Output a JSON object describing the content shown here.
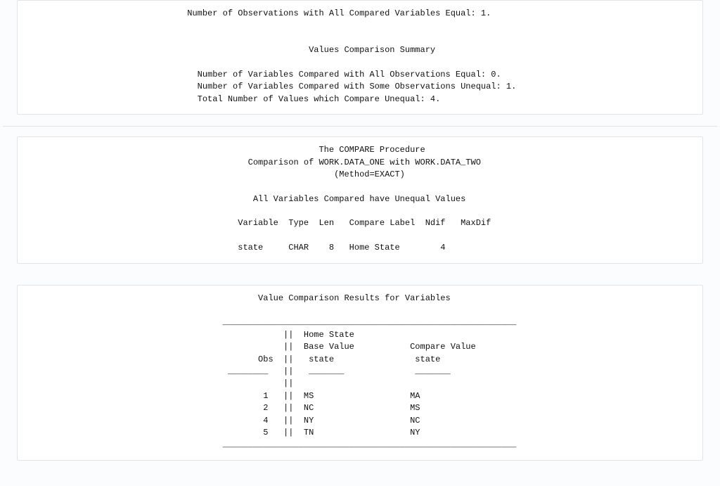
{
  "panel1": {
    "obs_equal_line": "                               Number of Observations with All Compared Variables Equal: 1.",
    "blank1": "",
    "blank2": "",
    "summary_title": "                                                       Values Comparison Summary",
    "blank3": "",
    "vars_all_equal": "                                 Number of Variables Compared with All Observations Equal: 0.",
    "vars_some_unequal": "                                 Number of Variables Compared with Some Observations Unequal: 1.",
    "total_unequal": "                                 Total Number of Values which Compare Unequal: 4."
  },
  "panel2": {
    "title1": "                                                         The COMPARE Procedure",
    "title2": "                                           Comparison of WORK.DATA_ONE with WORK.DATA_TWO",
    "title3": "                                                            (Method=EXACT)",
    "blank1": "",
    "heading": "                                            All Variables Compared have Unequal Values",
    "blank2": "",
    "col_header": "                                         Variable  Type  Len   Compare Label  Ndif   MaxDif",
    "blank3": "",
    "row1": "                                         state     CHAR    8   Home State        4"
  },
  "panel3": {
    "title": "                                             Value Comparison Results for Variables",
    "blank1": "",
    "rule_top": "                                      __________________________________________________________",
    "h1": "                                                  ||  Home State",
    "h2": "                                                  ||  Base Value           Compare Value",
    "h3": "                                             Obs  ||   state                state",
    "h_rule": "                                       ________   ||   _______              _______",
    "h_blankbar": "                                                  ||",
    "r1": "                                              1   ||  MS                   MA",
    "r2": "                                              2   ||  NC                   MS",
    "r3": "                                              4   ||  NY                   NC",
    "r4": "                                              5   ||  TN                   NY",
    "rule_bot": "                                      __________________________________________________________"
  },
  "chart_data": [
    {
      "type": "table",
      "title": "Values Comparison Summary",
      "rows": [
        [
          "Number of Observations with All Compared Variables Equal",
          1
        ],
        [
          "Number of Variables Compared with All Observations Equal",
          0
        ],
        [
          "Number of Variables Compared with Some Observations Unequal",
          1
        ],
        [
          "Total Number of Values which Compare Unequal",
          4
        ]
      ]
    },
    {
      "type": "table",
      "title": "All Variables Compared have Unequal Values",
      "headers": [
        "Variable",
        "Type",
        "Len",
        "Compare Label",
        "Ndif",
        "MaxDif"
      ],
      "rows": [
        [
          "state",
          "CHAR",
          8,
          "Home State",
          4,
          ""
        ]
      ]
    },
    {
      "type": "table",
      "title": "Value Comparison Results for Variables",
      "headers": [
        "Obs",
        "Base Value (state)",
        "Compare Value (state)"
      ],
      "rows": [
        [
          1,
          "MS",
          "MA"
        ],
        [
          2,
          "NC",
          "MS"
        ],
        [
          4,
          "NY",
          "NC"
        ],
        [
          5,
          "TN",
          "NY"
        ]
      ]
    }
  ]
}
